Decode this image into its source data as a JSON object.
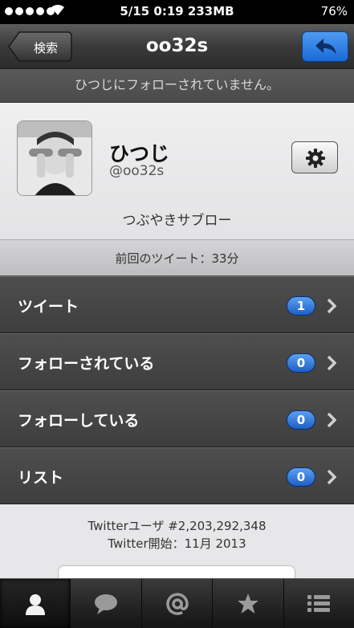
{
  "status_bar": {
    "time": "5/15 0:19 233MB",
    "battery": "76%"
  },
  "nav": {
    "back_label": "検索",
    "title": "oo32s",
    "reply_icon": "reply-icon"
  },
  "notice": "ひつじにフォローされていません。",
  "profile": {
    "name": "ひつじ",
    "handle": "@oo32s",
    "bio": "つぶやきサブロー",
    "settings_icon": "gear-icon"
  },
  "last_tweet": "前回のツイート：33分",
  "menu": [
    {
      "label": "ツイート",
      "count": "1"
    },
    {
      "label": "フォローされている",
      "count": "0"
    },
    {
      "label": "フォローしている",
      "count": "0"
    },
    {
      "label": "リスト",
      "count": "0"
    }
  ],
  "footer": {
    "user_number": "Twitterユーザ #2,203,292,348",
    "since": "Twitter開始：11月 2013"
  },
  "tabs": [
    {
      "icon": "profile-icon",
      "active": true
    },
    {
      "icon": "speech-bubble-icon",
      "active": false
    },
    {
      "icon": "mention-icon",
      "active": false
    },
    {
      "icon": "star-icon",
      "active": false
    },
    {
      "icon": "list-icon",
      "active": false
    }
  ],
  "colors": {
    "accent_blue": "#1f6ad8",
    "badge_blue": "#2f7be0",
    "dark_row": "#464646"
  }
}
